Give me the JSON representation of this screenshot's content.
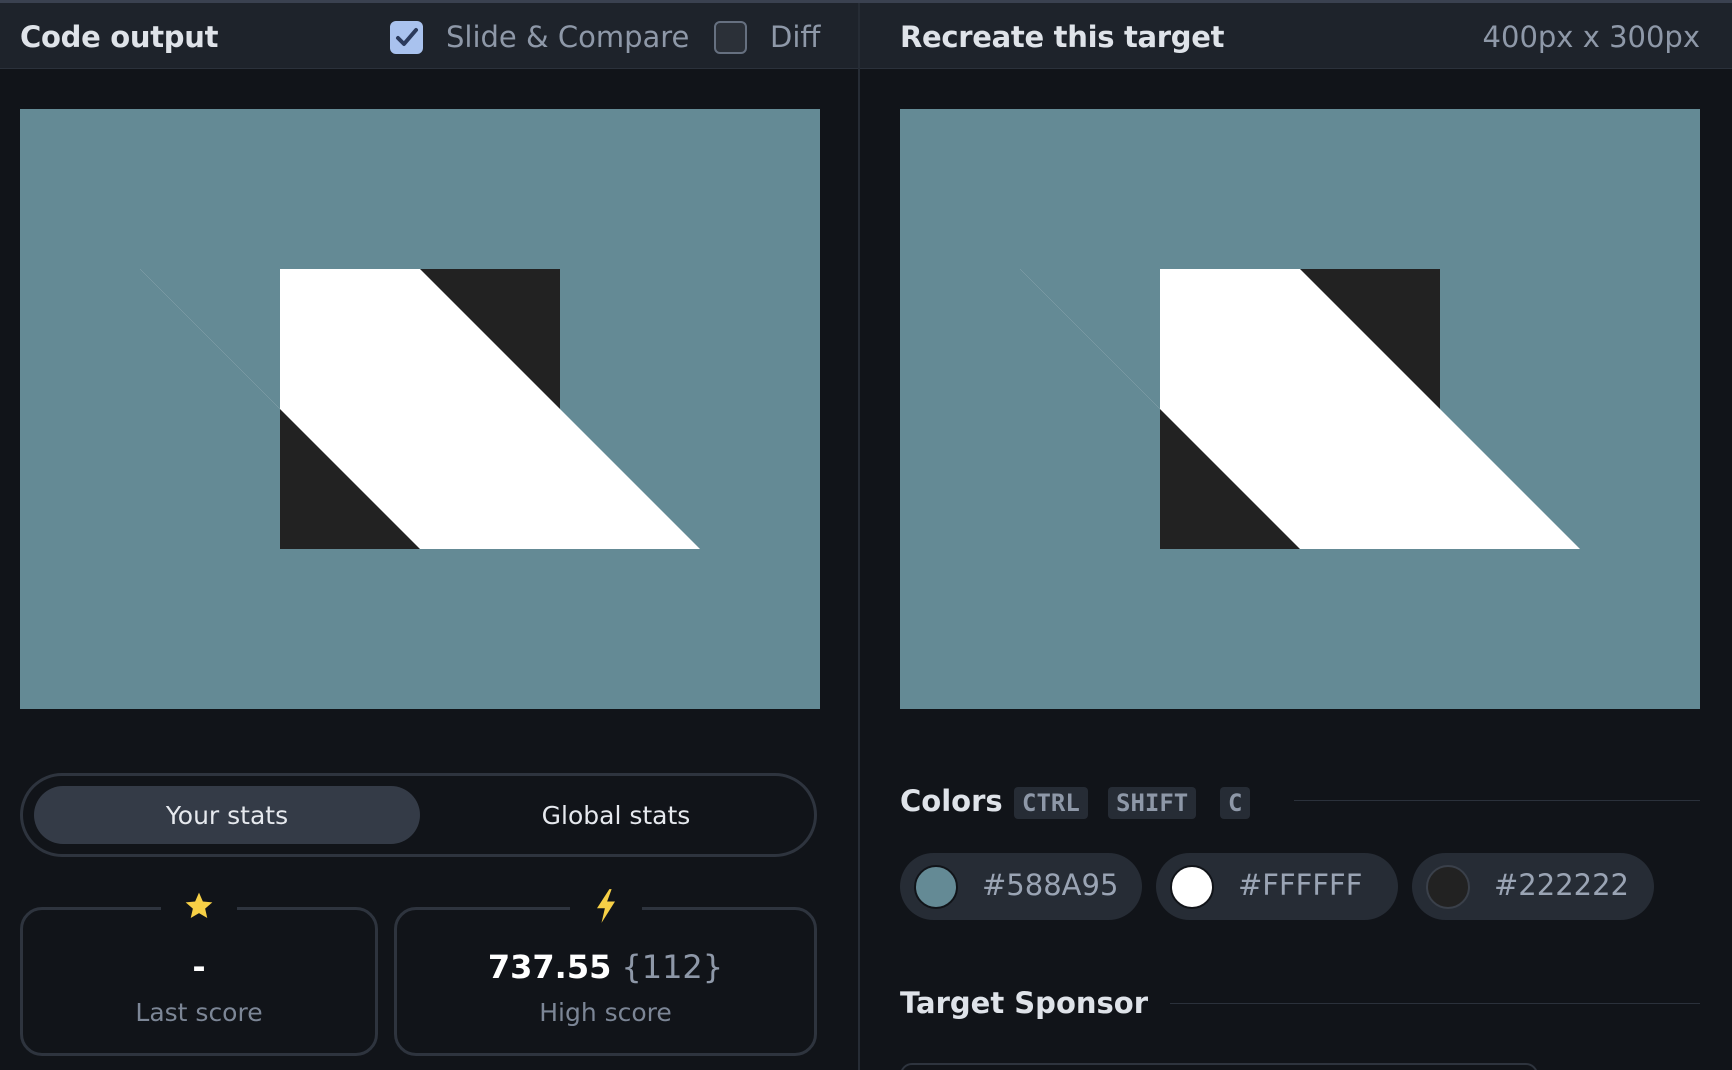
{
  "left_header": {
    "title": "Code output",
    "slide_compare_label": "Slide & Compare",
    "slide_compare_checked": true,
    "diff_label": "Diff",
    "diff_checked": false
  },
  "right_header": {
    "title": "Recreate this target",
    "dimensions": "400px x 300px"
  },
  "stats_tabs": {
    "your_stats": "Your stats",
    "global_stats": "Global stats"
  },
  "cards": {
    "last_score_value": "-",
    "last_score_label": "Last score",
    "high_score_value": "737.55",
    "high_score_sub": "{112}",
    "high_score_label": "High score"
  },
  "colors": {
    "title": "Colors",
    "shortcut_keys": [
      "CTRL",
      "SHIFT",
      "C"
    ],
    "swatches": [
      {
        "hex": "#588A95",
        "color": "#648a95"
      },
      {
        "hex": "#FFFFFF",
        "color": "#ffffff"
      },
      {
        "hex": "#222222",
        "color": "#222222"
      }
    ]
  },
  "sponsor": {
    "title": "Target Sponsor"
  },
  "icons": {
    "checkbox_checked": "check-icon",
    "last_score_icon": "star-icon",
    "high_score_icon": "lightning-icon"
  },
  "palette": {
    "canvas_bg": "#648a95",
    "shape_white": "#ffffff",
    "shape_dark": "#222222",
    "accent_yellow": "#f7d046",
    "checkbox_blue": "#a9c2ee"
  }
}
